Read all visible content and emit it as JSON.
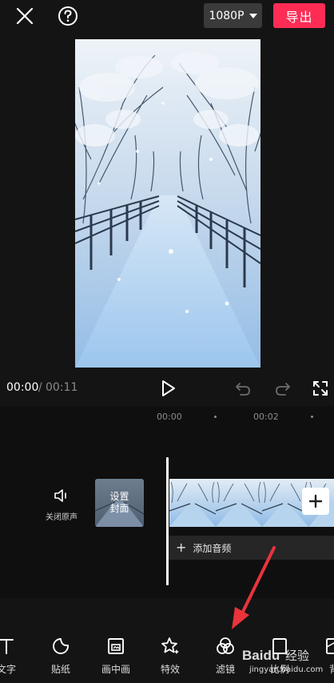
{
  "topbar": {
    "resolution": "1080P",
    "export_label": "导出",
    "close_icon": "close-icon",
    "help_icon": "help-icon"
  },
  "playback": {
    "current_time": "00:00",
    "separator": "/",
    "total_time": "00:11"
  },
  "timeline": {
    "ruler": [
      "00:00",
      "00:02"
    ],
    "mute_label": "关闭原声",
    "cover_label": "设置\n封面",
    "add_audio_label": "添加音频"
  },
  "toolbar": {
    "items": [
      {
        "label": "文字",
        "icon": "text-icon"
      },
      {
        "label": "贴纸",
        "icon": "sticker-icon"
      },
      {
        "label": "画中画",
        "icon": "picture-in-picture-icon"
      },
      {
        "label": "特效",
        "icon": "effects-icon"
      },
      {
        "label": "滤镜",
        "icon": "filter-icon"
      },
      {
        "label": "比例",
        "icon": "ratio-icon"
      },
      {
        "label": "背",
        "icon": "background-icon"
      }
    ]
  },
  "watermark": {
    "text": "jingyan.baidu.com",
    "brand": "Baidu 经验"
  },
  "colors": {
    "accent": "#fe2c55",
    "background": "#141414",
    "annotation_arrow": "#e8343a"
  }
}
